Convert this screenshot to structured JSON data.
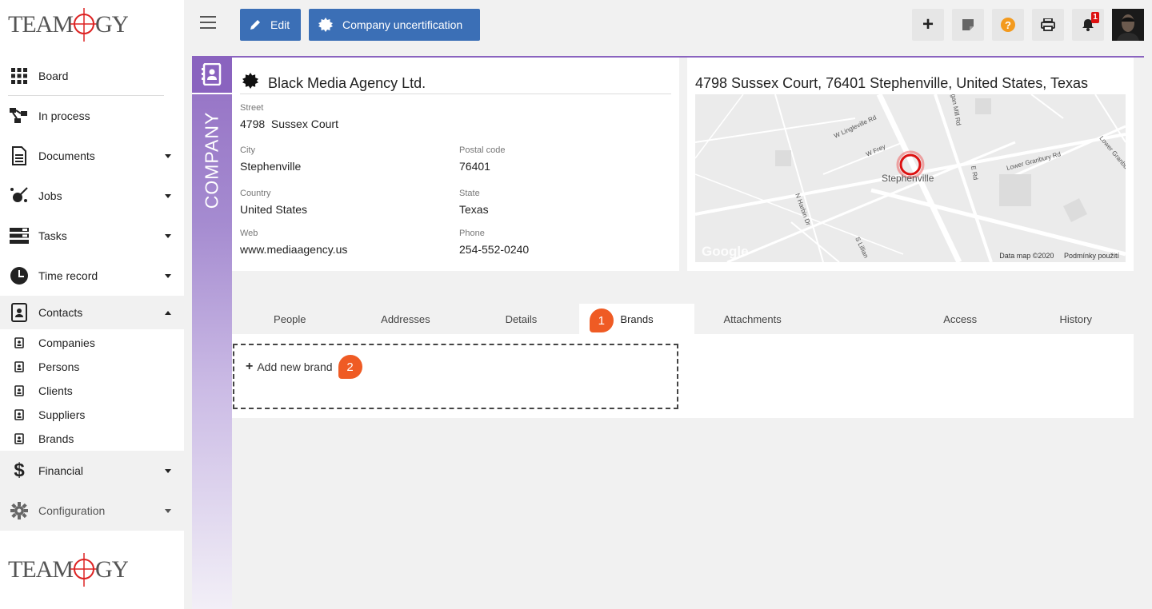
{
  "brand": {
    "logo_text": "TEAMOGY",
    "accent": "#8a63bf",
    "primary": "#3b6fb6",
    "step_color": "#ef5b24"
  },
  "sidebar": {
    "items": [
      {
        "label": "Board",
        "icon": "grid-icon"
      },
      {
        "label": "In process",
        "icon": "flow-icon"
      },
      {
        "label": "Documents",
        "icon": "document-icon"
      },
      {
        "label": "Jobs",
        "icon": "jobs-icon"
      },
      {
        "label": "Tasks",
        "icon": "tasks-icon"
      },
      {
        "label": "Time record",
        "icon": "clock-icon"
      },
      {
        "label": "Contacts",
        "icon": "contacts-icon"
      },
      {
        "label": "Financial",
        "icon": "dollar-icon"
      },
      {
        "label": "Configuration",
        "icon": "gear-icon"
      }
    ],
    "contacts_sub": [
      {
        "label": "Companies"
      },
      {
        "label": "Persons"
      },
      {
        "label": "Clients"
      },
      {
        "label": "Suppliers"
      },
      {
        "label": "Brands"
      }
    ]
  },
  "toolbar": {
    "edit_label": "Edit",
    "uncert_label": "Company uncertification",
    "notification_count": "1"
  },
  "module": {
    "label": "COMPANY"
  },
  "company": {
    "name": "Black Media Agency Ltd.",
    "street_label": "Street",
    "street": "4798  Sussex Court",
    "city_label": "City",
    "city": "Stephenville",
    "postal_label": "Postal code",
    "postal": "76401",
    "country_label": "Country",
    "country": "United States",
    "state_label": "State",
    "state": "Texas",
    "web_label": "Web",
    "web": "www.mediaagency.us",
    "phone_label": "Phone",
    "phone": "254-552-0240"
  },
  "map": {
    "title": "4798 Sussex Court, 76401 Stephenville, United States, Texas",
    "city_label": "Stephenville",
    "logo": "Google",
    "footer_data": "Data map ©2020",
    "footer_terms": "Podmínky použití"
  },
  "tabs": [
    {
      "label": "People"
    },
    {
      "label": "Addresses"
    },
    {
      "label": "Details"
    },
    {
      "label": "Brands"
    },
    {
      "label": "Attachments"
    },
    {
      "label": "Access"
    },
    {
      "label": "History"
    }
  ],
  "steps": {
    "one": "1",
    "two": "2"
  },
  "brands_panel": {
    "add_label": "Add new brand"
  }
}
